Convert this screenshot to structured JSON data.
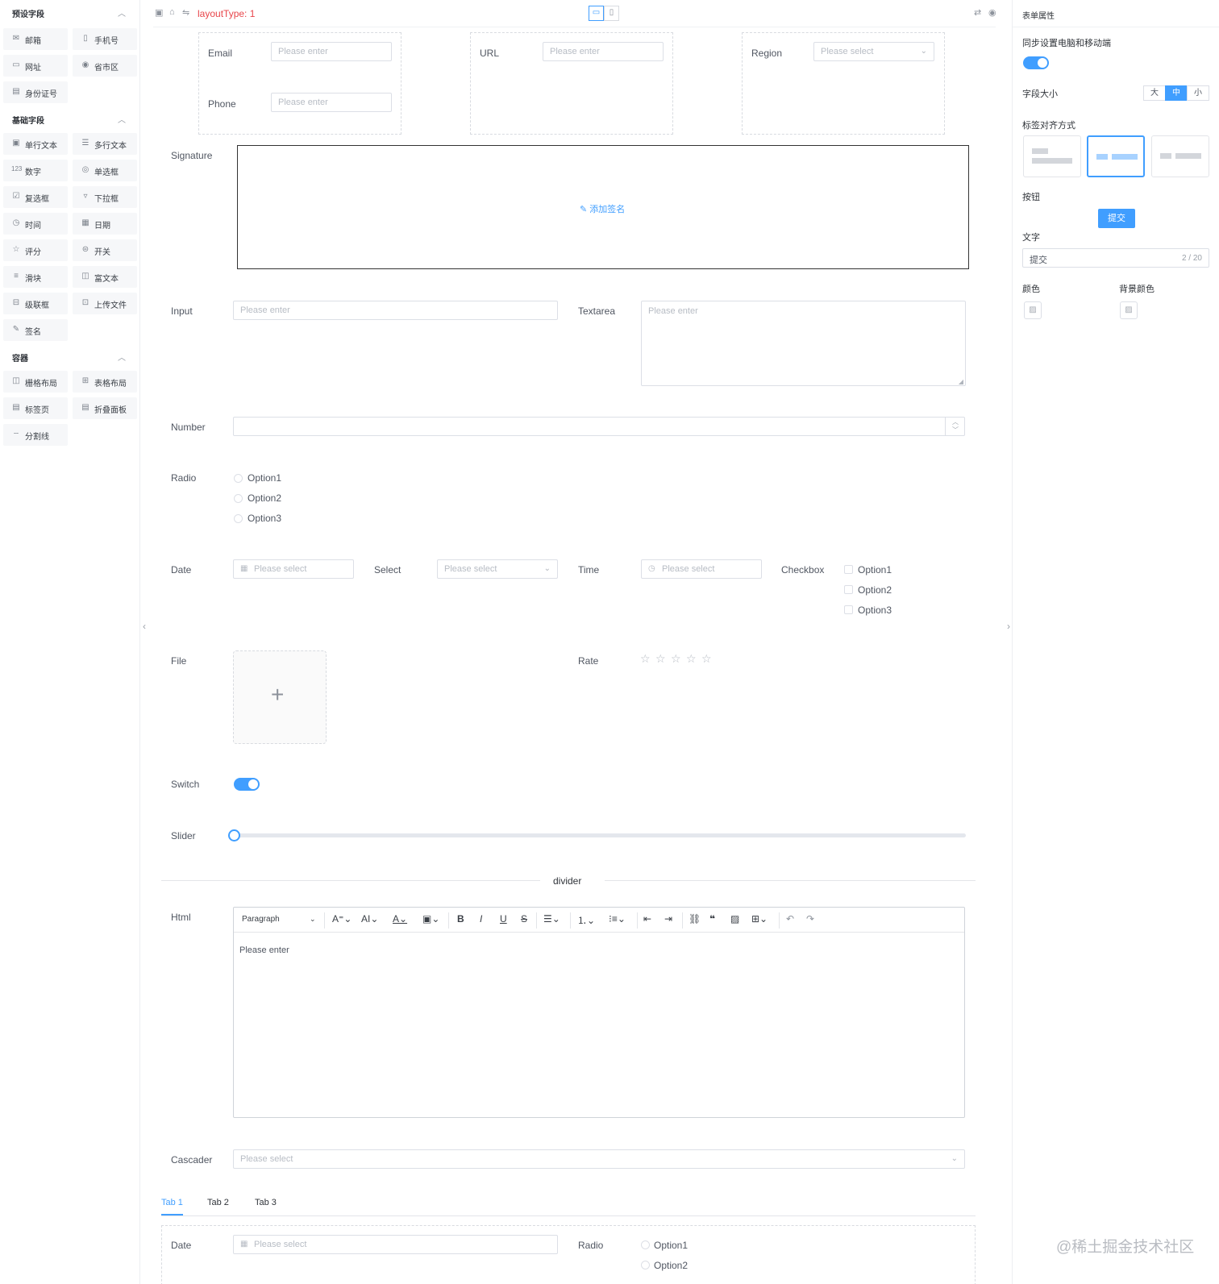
{
  "palette": {
    "groups": [
      {
        "title": "预设字段",
        "items": [
          {
            "icon": "mail-icon",
            "glyph": "✉",
            "label": "邮箱"
          },
          {
            "icon": "phone-icon",
            "glyph": "▯",
            "label": "手机号"
          },
          {
            "icon": "web-icon",
            "glyph": "▭",
            "label": "网址"
          },
          {
            "icon": "location-icon",
            "glyph": "◉",
            "label": "省市区"
          },
          {
            "icon": "id-card-icon",
            "glyph": "▤",
            "label": "身份证号"
          }
        ]
      },
      {
        "title": "基础字段",
        "items": [
          {
            "icon": "text-input-icon",
            "glyph": "▣",
            "label": "单行文本"
          },
          {
            "icon": "textarea-icon",
            "glyph": "☰",
            "label": "多行文本"
          },
          {
            "icon": "number-icon",
            "glyph": "123",
            "label": "数字"
          },
          {
            "icon": "radio-icon",
            "glyph": "◎",
            "label": "单选框"
          },
          {
            "icon": "checkbox-icon",
            "glyph": "☑",
            "label": "复选框"
          },
          {
            "icon": "dropdown-icon",
            "glyph": "▿",
            "label": "下拉框"
          },
          {
            "icon": "clock-icon",
            "glyph": "◷",
            "label": "时间"
          },
          {
            "icon": "calendar-icon",
            "glyph": "▦",
            "label": "日期"
          },
          {
            "icon": "star-icon",
            "glyph": "☆",
            "label": "评分"
          },
          {
            "icon": "switch-icon",
            "glyph": "⊜",
            "label": "开关"
          },
          {
            "icon": "slider-icon",
            "glyph": "≡",
            "label": "滑块"
          },
          {
            "icon": "rich-text-icon",
            "glyph": "◫",
            "label": "富文本"
          },
          {
            "icon": "cascader-icon",
            "glyph": "⊟",
            "label": "级联框"
          },
          {
            "icon": "upload-icon",
            "glyph": "⊡",
            "label": "上传文件"
          },
          {
            "icon": "signature-icon",
            "glyph": "✎",
            "label": "签名"
          }
        ]
      },
      {
        "title": "容器",
        "items": [
          {
            "icon": "grid-layout-icon",
            "glyph": "◫",
            "label": "栅格布局"
          },
          {
            "icon": "table-layout-icon",
            "glyph": "⊞",
            "label": "表格布局"
          },
          {
            "icon": "tabs-icon",
            "glyph": "▤",
            "label": "标签页"
          },
          {
            "icon": "collapse-icon",
            "glyph": "▤",
            "label": "折叠面板"
          },
          {
            "icon": "divider-icon",
            "glyph": "┄",
            "label": "分割线"
          }
        ]
      }
    ]
  },
  "toolbar": {
    "layout_type": "layoutType: 1",
    "icons": [
      "save-icon",
      "clear-icon",
      "switch-layout-icon",
      "desktop-icon",
      "mobile-icon",
      "translate-icon",
      "preview-icon"
    ]
  },
  "form": {
    "grid_fields": {
      "email": {
        "label": "Email",
        "placeholder": "Please enter"
      },
      "phone": {
        "label": "Phone",
        "placeholder": "Please enter"
      },
      "url": {
        "label": "URL",
        "placeholder": "Please enter"
      },
      "region": {
        "label": "Region",
        "placeholder": "Please select"
      }
    },
    "signature": {
      "label": "Signature",
      "action": "添加签名"
    },
    "input": {
      "label": "Input",
      "placeholder": "Please enter"
    },
    "textarea": {
      "label": "Textarea",
      "placeholder": "Please enter"
    },
    "number": {
      "label": "Number"
    },
    "radio": {
      "label": "Radio",
      "options": [
        "Option1",
        "Option2",
        "Option3"
      ]
    },
    "date": {
      "label": "Date",
      "placeholder": "Please select"
    },
    "select": {
      "label": "Select",
      "placeholder": "Please select"
    },
    "time": {
      "label": "Time",
      "placeholder": "Please select"
    },
    "checkbox": {
      "label": "Checkbox",
      "options": [
        "Option1",
        "Option2",
        "Option3"
      ]
    },
    "file": {
      "label": "File"
    },
    "rate": {
      "label": "Rate",
      "value": 0,
      "max": 5
    },
    "switch": {
      "label": "Switch",
      "on": true
    },
    "slider": {
      "label": "Slider",
      "value": 0
    },
    "divider": {
      "text": "divider"
    },
    "html": {
      "label": "Html",
      "paragraph": "Paragraph",
      "placeholder": "Please enter",
      "tools": [
        "font-size-icon",
        "line-height-icon",
        "font-color-icon",
        "bg-color-icon",
        "bold-icon",
        "italic-icon",
        "underline-icon",
        "strikethrough-icon",
        "align-icon",
        "ordered-list-icon",
        "bullet-list-icon",
        "outdent-icon",
        "indent-icon",
        "link-icon",
        "quote-icon",
        "image-icon",
        "table-icon",
        "undo-icon",
        "redo-icon"
      ]
    },
    "cascader": {
      "label": "Cascader",
      "placeholder": "Please select"
    },
    "tabs": {
      "items": [
        "Tab 1",
        "Tab 2",
        "Tab 3"
      ],
      "active": "Tab 1"
    },
    "tab_content": {
      "date": {
        "label": "Date",
        "placeholder": "Please select"
      },
      "radio": {
        "label": "Radio",
        "options": [
          "Option1",
          "Option2"
        ]
      }
    }
  },
  "props": {
    "title": "表单属性",
    "sync_label": "同步设置电脑和移动端",
    "sync_on": true,
    "size_label": "字段大小",
    "size_options": [
      "大",
      "中",
      "小"
    ],
    "size_active": "中",
    "align_label": "标签对齐方式",
    "button_label": "按钮",
    "button_text": "提交",
    "text_label": "文字",
    "text_value": "提交",
    "text_count": "2 / 20",
    "color_label": "颜色",
    "bg_color_label": "背景颜色"
  },
  "watermark": "@稀土掘金技术社区",
  "colors": {
    "accent": "#409eff",
    "layout_type": "#e8454a"
  }
}
